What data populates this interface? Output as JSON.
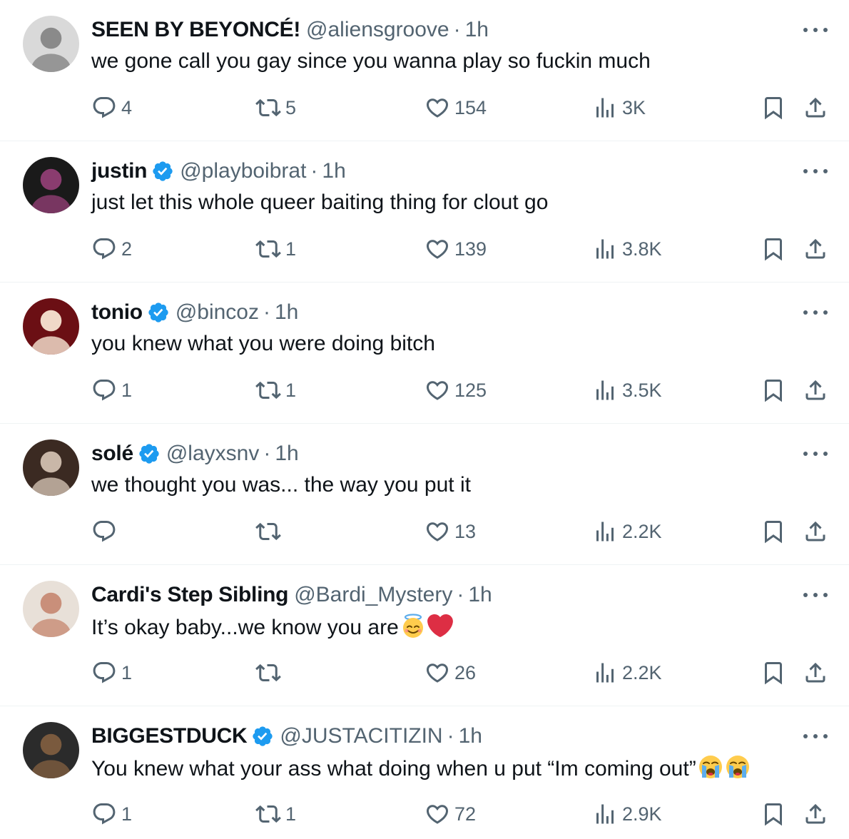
{
  "tweets": [
    {
      "name": "SEEN BY BEYONCÉ!",
      "verified": false,
      "handle": "@aliensgroove",
      "time": "1h",
      "text": "we gone call you gay since you wanna play so fuckin much",
      "emojis": [],
      "replies": "4",
      "retweets": "5",
      "likes": "154",
      "views": "3K",
      "avatar_colors": [
        "#d9d9d9",
        "#8a8a8a"
      ]
    },
    {
      "name": "justin",
      "verified": true,
      "handle": "@playboibrat",
      "time": "1h",
      "text": "just let this whole queer baiting thing for clout go",
      "emojis": [],
      "replies": "2",
      "retweets": "1",
      "likes": "139",
      "views": "3.8K",
      "avatar_colors": [
        "#1a1a1a",
        "#8a3c6f"
      ]
    },
    {
      "name": "tonio",
      "verified": true,
      "handle": "@bincoz",
      "time": "1h",
      "text": "you knew what you were doing bitch",
      "emojis": [],
      "replies": "1",
      "retweets": "1",
      "likes": "125",
      "views": "3.5K",
      "avatar_colors": [
        "#6b0f14",
        "#f0d9c8"
      ]
    },
    {
      "name": "solé",
      "verified": true,
      "handle": "@layxsnv",
      "time": "1h",
      "text": "we thought you was... the way you put it",
      "emojis": [],
      "replies": "",
      "retweets": "",
      "likes": "13",
      "views": "2.2K",
      "avatar_colors": [
        "#3b2a22",
        "#c9b7a8"
      ]
    },
    {
      "name": "Cardi's Step Sibling",
      "verified": false,
      "handle": "@Bardi_Mystery",
      "time": "1h",
      "text": "It’s okay baby...we know you are",
      "emojis": [
        "smiling-face-with-halo",
        "red-heart"
      ],
      "replies": "1",
      "retweets": "",
      "likes": "26",
      "views": "2.2K",
      "avatar_colors": [
        "#e8e0d8",
        "#c98f7a"
      ]
    },
    {
      "name": "BIGGESTDUCK",
      "verified": true,
      "handle": "@JUSTACITIZIN",
      "time": "1h",
      "text": "You knew what your ass what doing when u put “Im coming out”",
      "emojis": [
        "loudly-crying-face",
        "loudly-crying-face"
      ],
      "replies": "1",
      "retweets": "1",
      "likes": "72",
      "views": "2.9K",
      "avatar_colors": [
        "#2b2b2b",
        "#7a5a3e"
      ]
    }
  ],
  "colors": {
    "text": "#0f1419",
    "secondary": "#536471",
    "verified": "#1d9bf0",
    "divider": "#eff3f4"
  }
}
